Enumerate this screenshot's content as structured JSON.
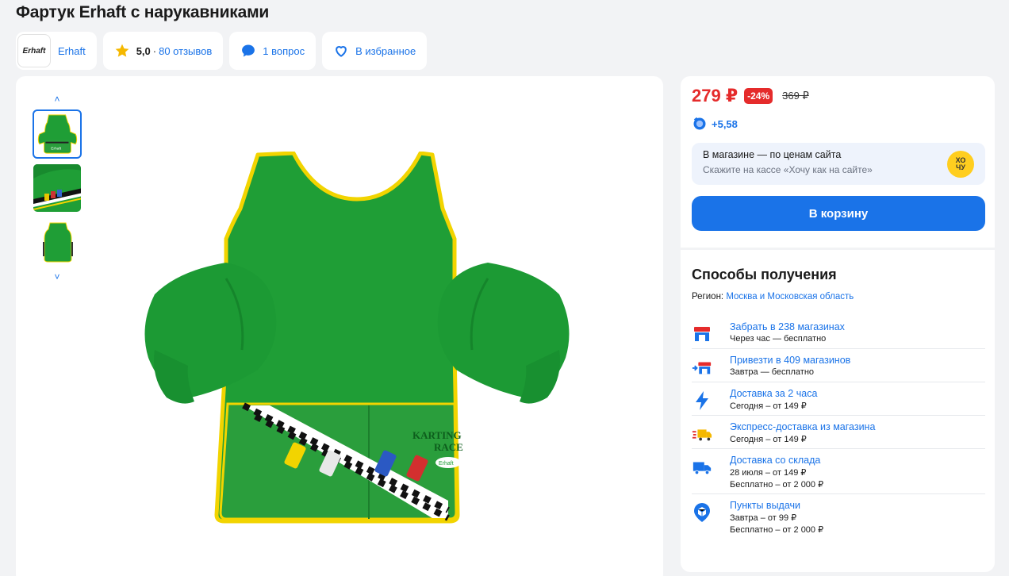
{
  "title": "Фартук Erhaft с нарукавниками",
  "brand": {
    "logo_text": "Erhaft",
    "name": "Erhaft"
  },
  "rating": {
    "value": "5,0",
    "separator": "·",
    "reviews": "80 отзывов"
  },
  "questions": "1 вопрос",
  "favorite": "В избранное",
  "gallery": {
    "up_arrow": "˄",
    "down_arrow": "˅"
  },
  "product_image": {
    "print_title_1": "KARTING",
    "print_title_2": "RACE",
    "print_brand": "Erhaft",
    "thumb_label": "Erhaft"
  },
  "price": {
    "current": "279 ₽",
    "discount": "-24%",
    "old": "369 ₽",
    "bonus": "+5,58"
  },
  "store": {
    "title": "В магазине — по ценам сайта",
    "subtitle": "Скажите на кассе «Хочу как на сайте»",
    "badge_line1": "ХО",
    "badge_line2": "ЧУ"
  },
  "cart_button": "В корзину",
  "delivery": {
    "title": "Способы получения",
    "region_label": "Регион:",
    "region_value": "Москва и Московская область",
    "options": [
      {
        "label": "Забрать в 238 магазинах",
        "line1": "Через час — бесплатно",
        "line2": ""
      },
      {
        "label": "Привезти в 409 магазинов",
        "line1": "Завтра — бесплатно",
        "line2": ""
      },
      {
        "label": "Доставка за 2 часа",
        "line1": "Сегодня – от 149 ₽",
        "line2": ""
      },
      {
        "label": "Экспресс-доставка из магазина",
        "line1": "Сегодня – от 149 ₽",
        "line2": ""
      },
      {
        "label": "Доставка со склада",
        "line1": "28 июля – от 149 ₽",
        "line2": "Бесплатно  – от 2 000 ₽"
      },
      {
        "label": "Пункты выдачи",
        "line1": "Завтра – от 99 ₽",
        "line2": "Бесплатно  – от 2 000 ₽"
      }
    ]
  },
  "colors": {
    "accent": "#1a73e8",
    "price": "#e52b2b",
    "apron": "#1f9e36",
    "trim": "#f2d400"
  }
}
